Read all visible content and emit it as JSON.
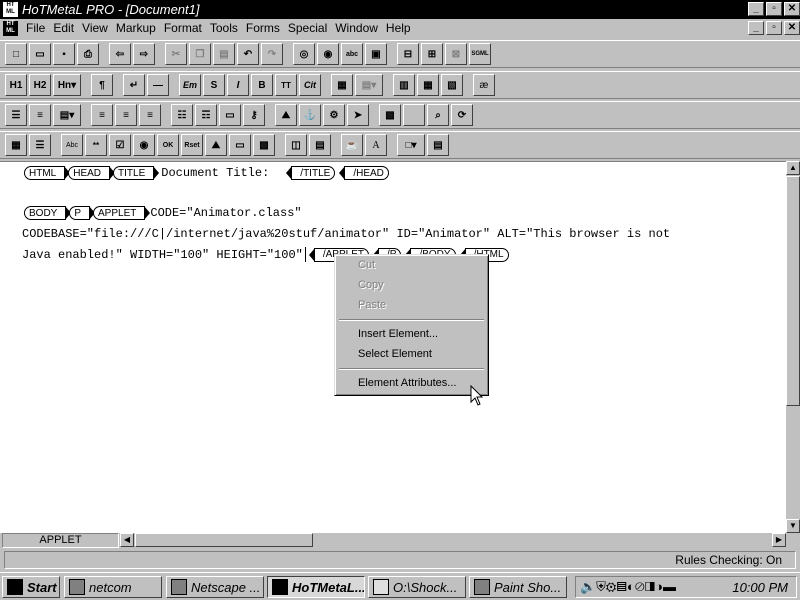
{
  "window": {
    "title": "HoTMetaL PRO - [Document1]",
    "app_icon": "HoTMetaL-logo"
  },
  "menu": [
    "File",
    "Edit",
    "View",
    "Markup",
    "Format",
    "Tools",
    "Forms",
    "Special",
    "Window",
    "Help"
  ],
  "toolbar1": [
    "new",
    "open",
    "save",
    "print",
    "back",
    "forward",
    "cut",
    "copy",
    "paste",
    "undo",
    "redo",
    "find",
    "find-next",
    "abc",
    "spell",
    "hide",
    "show",
    "validate",
    "SGML"
  ],
  "toolbar2": [
    "H1",
    "H2",
    "Hn",
    "¶",
    "↵",
    "—",
    "Em",
    "S",
    "I",
    "B",
    "TT",
    "Cit",
    "",
    "",
    "",
    "",
    "",
    "æ"
  ],
  "toolbar3": [
    "ul",
    "ol",
    "list",
    "left",
    "center",
    "right",
    "dl",
    "dd",
    "hr",
    "img",
    "anchor",
    "a",
    "img2",
    "",
    "",
    "",
    ""
  ],
  "toolbar4": [
    "table",
    "tr",
    "Abc",
    "**",
    "☑",
    "◉",
    "OK",
    "Rset",
    "",
    "",
    "",
    "",
    "",
    "",
    "A",
    "",
    "",
    ""
  ],
  "editor": {
    "line1": {
      "tags_open": [
        "HTML",
        "HEAD",
        "TITLE"
      ],
      "text": "Document Title:",
      "tags_close": [
        "/TITLE",
        "/HEAD"
      ]
    },
    "line2": {
      "tags_open": [
        "BODY",
        "P",
        "APPLET"
      ],
      "text": "CODE=\"Animator.class\""
    },
    "line3": {
      "text": "CODEBASE=\"file:///C|/internet/java%20stuf/animator\" ID=\"Animator\" ALT=\"This browser is not"
    },
    "line4": {
      "text": "Java enabled!\" WIDTH=\"100\" HEIGHT=\"100\"",
      "tags_close": [
        "/APPLET",
        "/P",
        "/BODY",
        "/HTML"
      ]
    }
  },
  "context_menu": {
    "items": [
      {
        "label": "Cut",
        "enabled": false
      },
      {
        "label": "Copy",
        "enabled": false
      },
      {
        "label": "Paste",
        "enabled": false
      },
      {
        "label": "Insert Element...",
        "enabled": true
      },
      {
        "label": "Select Element",
        "enabled": true
      },
      {
        "label": "Element Attributes...",
        "enabled": true
      }
    ]
  },
  "status": {
    "element": "APPLET",
    "rules": "Rules Checking: On"
  },
  "taskbar": {
    "start": "Start",
    "tasks": [
      "netcom",
      "Netscape ...",
      "HoTMetaL...",
      "O:\\Shock...",
      "Paint Sho..."
    ],
    "clock": "10:00 PM"
  }
}
